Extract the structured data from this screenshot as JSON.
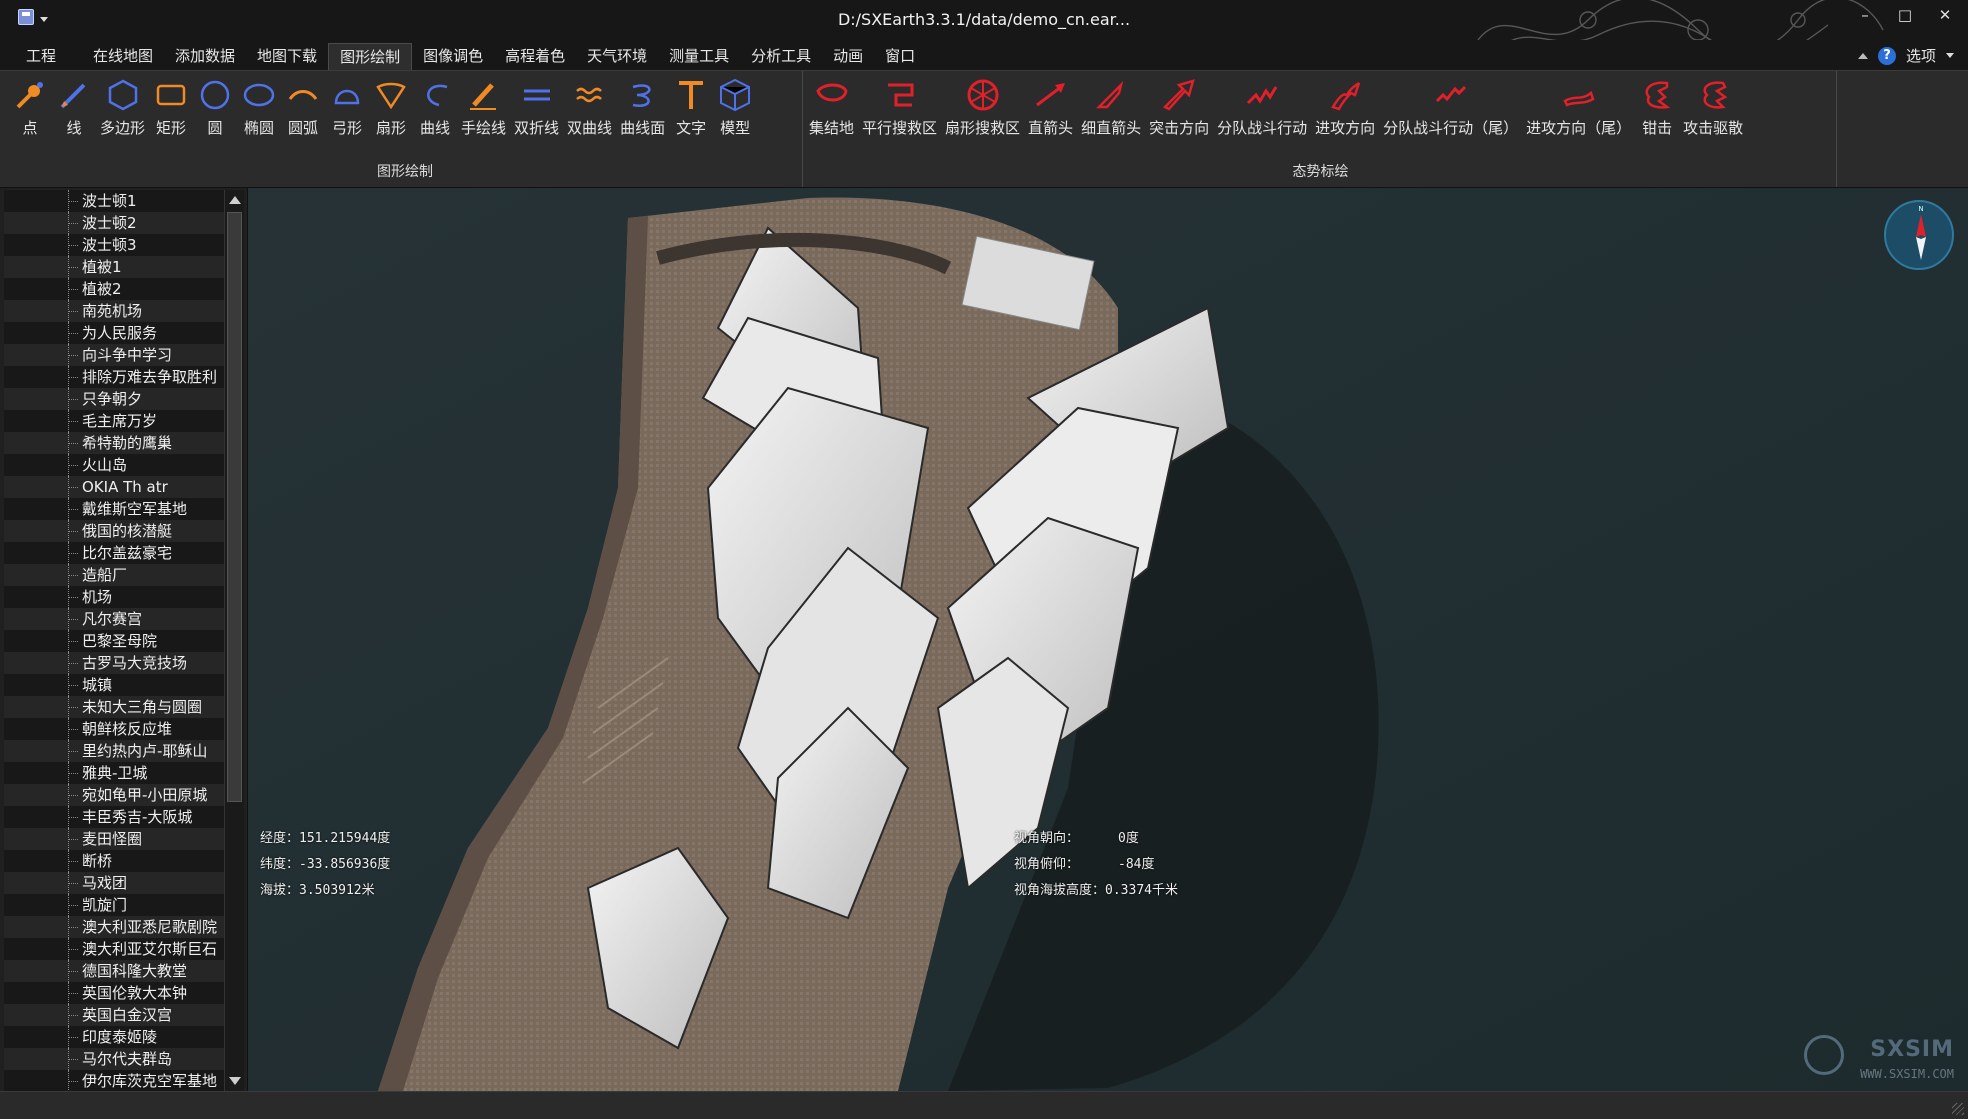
{
  "window": {
    "title": "D:/SXEarth3.3.1/data/demo_cn.ear...",
    "minimize": "–",
    "maximize": "□",
    "close": "✕"
  },
  "menu": {
    "tabs": [
      "工程",
      "在线地图",
      "添加数据",
      "地图下载",
      "图形绘制",
      "图像调色",
      "高程着色",
      "天气环境",
      "测量工具",
      "分析工具",
      "动画",
      "窗口"
    ],
    "active_index": 4,
    "options_label": "选项"
  },
  "ribbon": {
    "drawing": {
      "title": "图形绘制",
      "items": [
        {
          "label": "点",
          "icon": "point-icon"
        },
        {
          "label": "线",
          "icon": "line-icon"
        },
        {
          "label": "多边形",
          "icon": "polygon-icon"
        },
        {
          "label": "矩形",
          "icon": "rectangle-icon"
        },
        {
          "label": "圆",
          "icon": "circle-icon"
        },
        {
          "label": "椭圆",
          "icon": "ellipse-icon"
        },
        {
          "label": "圆弧",
          "icon": "arc-icon"
        },
        {
          "label": "弓形",
          "icon": "bow-icon"
        },
        {
          "label": "扇形",
          "icon": "sector-icon"
        },
        {
          "label": "曲线",
          "icon": "curve-icon"
        },
        {
          "label": "手绘线",
          "icon": "freehand-icon"
        },
        {
          "label": "双折线",
          "icon": "double-polyline-icon"
        },
        {
          "label": "双曲线",
          "icon": "double-curve-icon"
        },
        {
          "label": "曲线面",
          "icon": "curve-surface-icon"
        },
        {
          "label": "文字",
          "icon": "text-icon"
        },
        {
          "label": "模型",
          "icon": "model-icon"
        }
      ]
    },
    "situation": {
      "title": "态势标绘",
      "items": [
        {
          "label": "集结地",
          "icon": "assembly-area-icon"
        },
        {
          "label": "平行搜救区",
          "icon": "parallel-search-icon"
        },
        {
          "label": "扇形搜救区",
          "icon": "sector-search-icon"
        },
        {
          "label": "直箭头",
          "icon": "straight-arrow-icon"
        },
        {
          "label": "细直箭头",
          "icon": "thin-arrow-icon"
        },
        {
          "label": "突击方向",
          "icon": "assault-direction-icon"
        },
        {
          "label": "分队战斗行动",
          "icon": "squad-action-icon"
        },
        {
          "label": "进攻方向",
          "icon": "attack-direction-icon"
        },
        {
          "label": "分队战斗行动（尾）",
          "icon": "squad-action-tail-icon"
        },
        {
          "label": "进攻方向（尾）",
          "icon": "attack-direction-tail-icon"
        },
        {
          "label": "钳击",
          "icon": "pincer-icon"
        },
        {
          "label": "攻击驱散",
          "icon": "attack-disperse-icon"
        }
      ]
    }
  },
  "tree": {
    "items": [
      "波士顿1",
      "波士顿2",
      "波士顿3",
      "植被1",
      "植被2",
      "南苑机场",
      "为人民服务",
      "向斗争中学习",
      "排除万难去争取胜利",
      "只争朝夕",
      "毛主席万岁",
      "希特勒的鹰巢",
      "火山岛",
      "OKIA Th atr",
      "戴维斯空军基地",
      "俄国的核潜艇",
      "比尔盖兹豪宅",
      "造船厂",
      "机场",
      "凡尔赛宫",
      "巴黎圣母院",
      "古罗马大竞技场",
      "城镇",
      "未知大三角与圆圈",
      "朝鲜核反应堆",
      "里约热内卢-耶稣山",
      "雅典-卫城",
      "宛如龟甲-小田原城",
      "丰臣秀吉-大阪城",
      "麦田怪圈",
      "断桥",
      "马戏团",
      "凯旋门",
      "澳大利亚悉尼歌剧院",
      "澳大利亚艾尔斯巨石",
      "德国科隆大教堂",
      "英国伦敦大本钟",
      "英国白金汉宫",
      "印度泰姬陵",
      "马尔代夫群岛",
      "伊尔库茨克空军基地"
    ]
  },
  "map": {
    "longitude_label": "经度：",
    "longitude": "151.215944度",
    "latitude_label": "纬度：",
    "latitude": "-33.856936度",
    "altitude_label": "海拔：",
    "altitude": "3.503912米",
    "heading_label": "视角朝向：",
    "heading": "0度",
    "pitch_label": "视角俯仰：",
    "pitch": "-84度",
    "cam_alt_label": "视角海拔高度：",
    "cam_alt": "0.3374千米",
    "watermark": "SXSIM",
    "watermark_url": "WWW.SXSIM.COM"
  },
  "colors": {
    "drawing_accent": "#f08a24",
    "drawing_blue": "#4f72e8",
    "situation_red": "#e0202a",
    "background": "#1c1c1c"
  }
}
